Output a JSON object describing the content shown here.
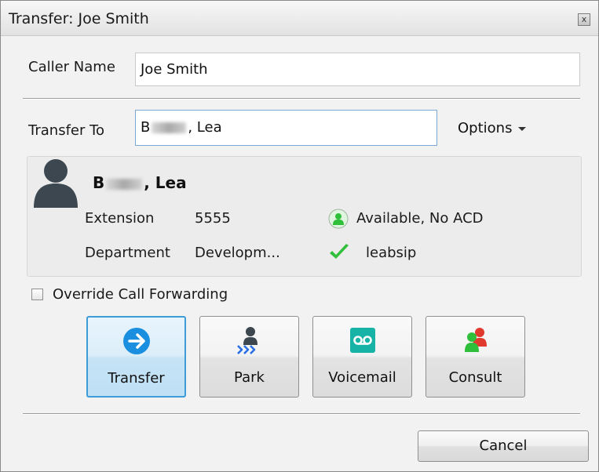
{
  "dialog": {
    "title": "Transfer: Joe Smith",
    "close_glyph": "x"
  },
  "caller": {
    "label": "Caller Name",
    "value": "Joe Smith"
  },
  "transfer_to": {
    "label": "Transfer To",
    "value_prefix": "B",
    "value_suffix": ", Lea",
    "options_label": "Options"
  },
  "contact": {
    "name_prefix": "B",
    "name_suffix": ", Lea",
    "extension_label": "Extension",
    "extension_value": "5555",
    "department_label": "Department",
    "department_value": "Developm...",
    "status": "Available, No ACD",
    "station": "leabsip",
    "icons": {
      "avatar": "person-silhouette-icon",
      "status": "available-status-icon",
      "station": "checkmark-icon"
    }
  },
  "override": {
    "label": "Override Call Forwarding",
    "checked": false
  },
  "actions": [
    {
      "label": "Transfer",
      "icon": "transfer-arrow-icon"
    },
    {
      "label": "Park",
      "icon": "park-icon"
    },
    {
      "label": "Voicemail",
      "icon": "voicemail-icon"
    },
    {
      "label": "Consult",
      "icon": "consult-icon"
    }
  ],
  "footer": {
    "cancel_label": "Cancel"
  },
  "colors": {
    "selected_border": "#3d9bd6",
    "transfer_blue": "#1a8fe0",
    "voicemail_teal": "#17b3a6",
    "available_green": "#2fbf3a",
    "consult_red": "#e03a2e"
  }
}
